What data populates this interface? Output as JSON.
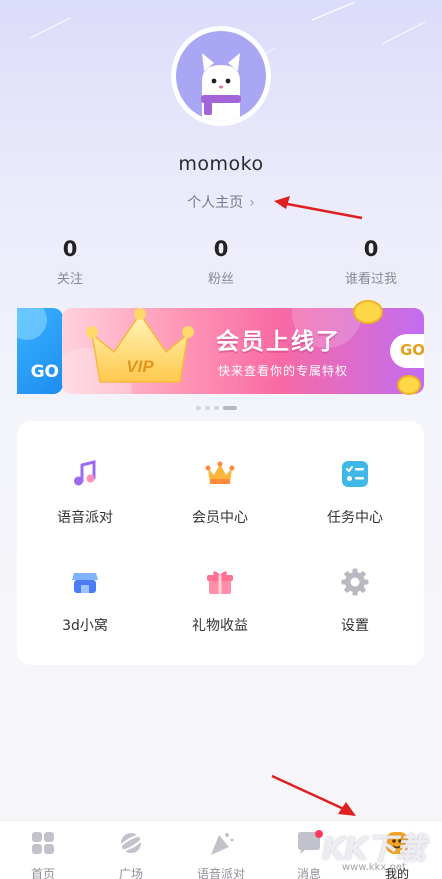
{
  "profile": {
    "username": "momoko",
    "homepage_label": "个人主页",
    "chevron": "›"
  },
  "stats": [
    {
      "value": "0",
      "label": "关注"
    },
    {
      "value": "0",
      "label": "粉丝"
    },
    {
      "value": "0",
      "label": "谁看过我"
    }
  ],
  "banner": {
    "badge": "VIP",
    "title": "会员上线了",
    "subtitle": "快来查看你的专属特权",
    "go_label": "GO",
    "prev_go_label": "GO",
    "page_count": 4,
    "active_page": 3
  },
  "features": [
    {
      "label": "语音派对",
      "icon": "music-note-icon"
    },
    {
      "label": "会员中心",
      "icon": "crown-icon"
    },
    {
      "label": "任务中心",
      "icon": "task-list-icon"
    },
    {
      "label": "3d小窝",
      "icon": "shop-icon"
    },
    {
      "label": "礼物收益",
      "icon": "gift-icon"
    },
    {
      "label": "设置",
      "icon": "gear-icon"
    }
  ],
  "tabbar": [
    {
      "label": "首页",
      "icon": "home-grid-icon"
    },
    {
      "label": "广场",
      "icon": "planet-icon"
    },
    {
      "label": "语音派对",
      "icon": "party-icon"
    },
    {
      "label": "消息",
      "icon": "message-icon"
    },
    {
      "label": "我的",
      "icon": "me-icon",
      "active": true
    }
  ],
  "watermark": {
    "logo": "KK下载",
    "url": "www.kkx.net"
  },
  "colors": {
    "accent_purple": "#a9a7f4",
    "annotation_red": "#e02020",
    "active_tab": "#f5a623",
    "message_dot": "#ff3b5c"
  }
}
